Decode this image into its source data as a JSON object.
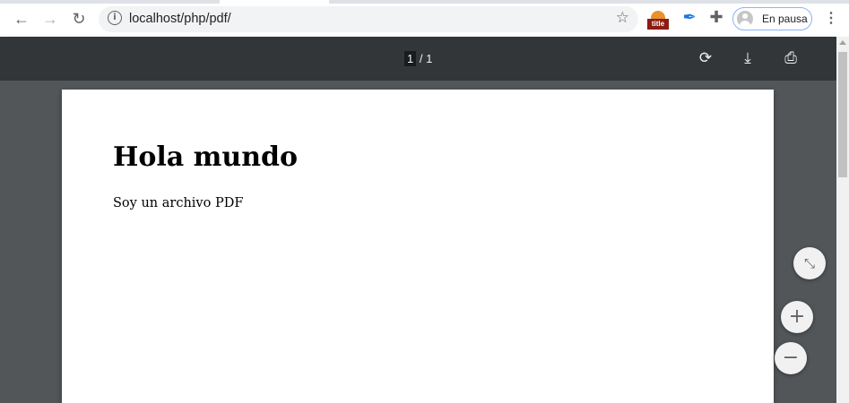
{
  "browser": {
    "address": "localhost/php/pdf/",
    "extensions": [
      "title-extension",
      "quill-extension",
      "puzzle-extension"
    ],
    "title_ext_label": "title",
    "profile_status": "En pausa"
  },
  "pdf_toolbar": {
    "current_page": "1",
    "total_pages": "/ 1"
  },
  "document": {
    "heading": "Hola mundo",
    "paragraph": "Soy un archivo PDF"
  },
  "colors": {
    "toolbar_bg": "#ffffff",
    "pdf_bar_bg": "#323639",
    "viewer_bg": "#525659",
    "accent": "#1a73e8"
  }
}
